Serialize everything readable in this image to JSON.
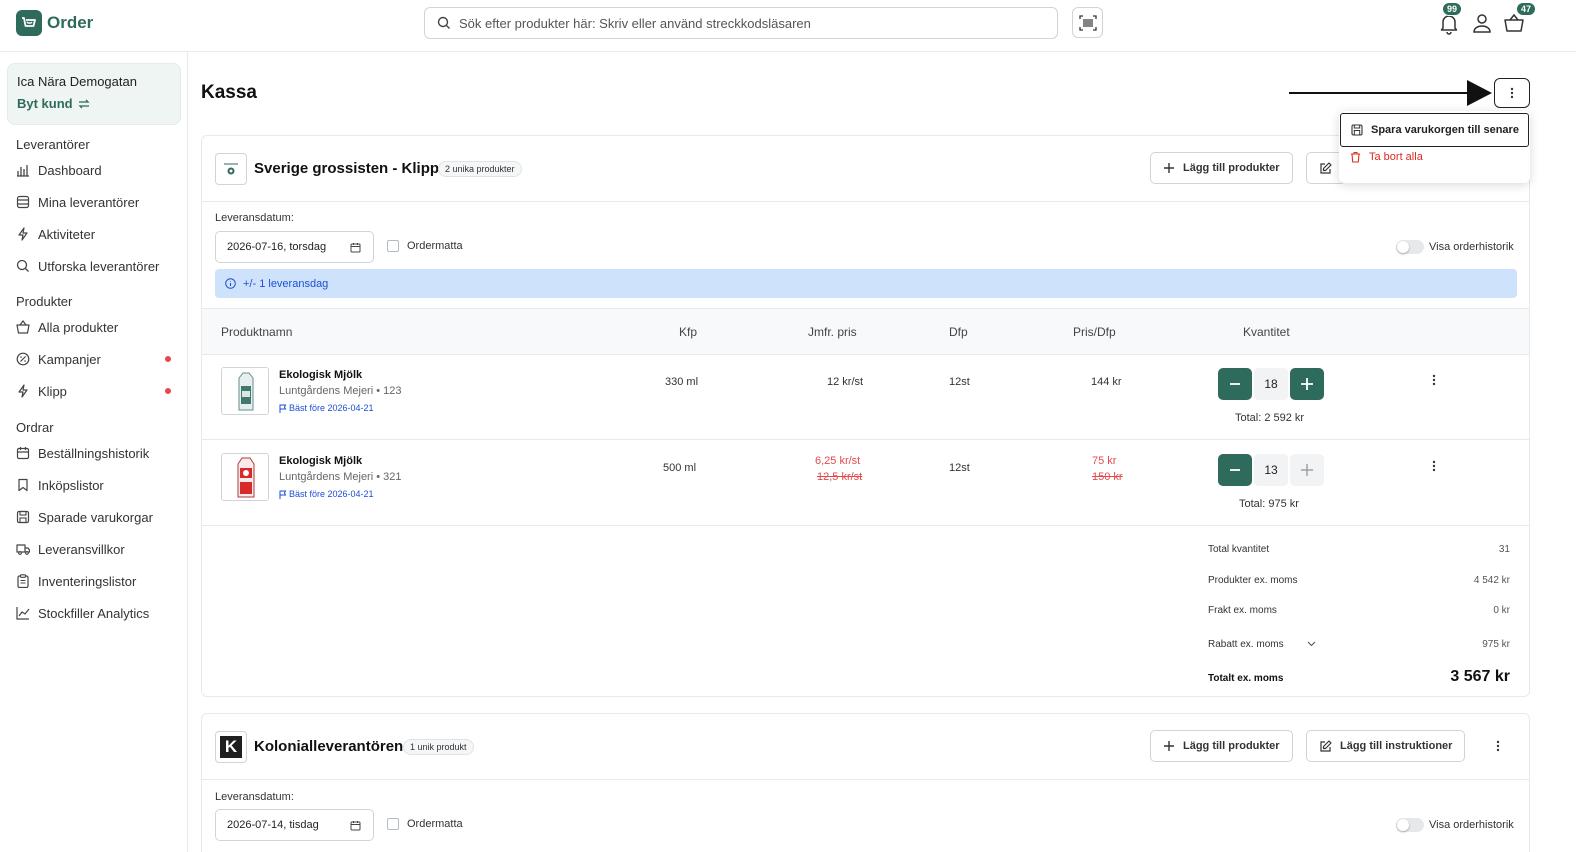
{
  "header": {
    "app_name": "Order",
    "search_placeholder": "Sök efter produkter här: Skriv eller använd streckkodsläsaren",
    "notifications_count": "99",
    "cart_count": "47"
  },
  "sidebar": {
    "customer_name": "Ica Nära Demogatan",
    "switch_customer": "Byt kund",
    "sections": [
      {
        "title": "Leverantörer",
        "items": [
          {
            "label": "Dashboard",
            "icon": "chart-icon"
          },
          {
            "label": "Mina leverantörer",
            "icon": "database-icon"
          },
          {
            "label": "Aktiviteter",
            "icon": "bolt-icon"
          },
          {
            "label": "Utforska leverantörer",
            "icon": "search-icon"
          }
        ]
      },
      {
        "title": "Produkter",
        "items": [
          {
            "label": "Alla produkter",
            "icon": "basket-icon"
          },
          {
            "label": "Kampanjer",
            "icon": "tag-icon",
            "dot": true
          },
          {
            "label": "Klipp",
            "icon": "bolt-icon",
            "dot": true
          }
        ]
      },
      {
        "title": "Ordrar",
        "items": [
          {
            "label": "Beställningshistorik",
            "icon": "calendar-icon"
          },
          {
            "label": "Inköpslistor",
            "icon": "bookmark-icon"
          },
          {
            "label": "Sparade varukorgar",
            "icon": "save-icon"
          },
          {
            "label": "Leveransvillkor",
            "icon": "truck-icon"
          },
          {
            "label": "Inventeringslistor",
            "icon": "clipboard-icon"
          },
          {
            "label": "Stockfiller Analytics",
            "icon": "line-chart-icon"
          }
        ]
      }
    ]
  },
  "page": {
    "title": "Kassa",
    "menu": {
      "save_cart": "Spara varukorgen till senare",
      "delete_all": "Ta bort alla"
    }
  },
  "supplier1": {
    "name": "Sverige grossisten - Klipp",
    "tag": "2 unika produkter",
    "add_products": "Lägg till produkter",
    "delivery_label": "Leveransdatum:",
    "delivery_date": "2026-07-16, torsdag",
    "ordermatta": "Ordermatta",
    "order_history": "Visa orderhistorik",
    "info": "+/- 1 leveransdag",
    "columns": {
      "name": "Produktnamn",
      "kfp": "Kfp",
      "jmfr": "Jmfr. pris",
      "dfp": "Dfp",
      "pris": "Pris/Dfp",
      "qty": "Kvantitet"
    },
    "products": [
      {
        "name": "Ekologisk Mjölk",
        "supplier": "Luntgårdens Mejeri • 123",
        "best_before": "Bäst före 2026-04-21",
        "kfp": "330 ml",
        "jmfr": "12 kr/st",
        "dfp": "12st",
        "price": "144 kr",
        "qty": "18",
        "total": "Total: 2 592 kr"
      },
      {
        "name": "Ekologisk Mjölk",
        "supplier": "Luntgårdens Mejeri • 321",
        "best_before": "Bäst före 2026-04-21",
        "kfp": "500 ml",
        "jmfr": "6,25 kr/st",
        "jmfr_old": "12,5 kr/st",
        "dfp": "12st",
        "price": "75 kr",
        "price_old": "150 kr",
        "qty": "13",
        "total": "Total: 975 kr"
      }
    ],
    "summary": {
      "total_qty_label": "Total kvantitet",
      "total_qty": "31",
      "products_label": "Produkter ex. moms",
      "products": "4 542 kr",
      "freight_label": "Frakt ex. moms",
      "freight": "0 kr",
      "discount_label": "Rabatt ex. moms",
      "discount": "975 kr",
      "total_label": "Totalt ex. moms",
      "total": "3 567 kr"
    }
  },
  "supplier2": {
    "name": "Kolonialleverantören",
    "tag": "1 unik produkt",
    "logo_letter": "K",
    "add_products": "Lägg till produkter",
    "add_instructions": "Lägg till instruktioner",
    "delivery_label": "Leveransdatum:",
    "delivery_date": "2026-07-14, tisdag",
    "ordermatta": "Ordermatta",
    "order_history": "Visa orderhistorik"
  },
  "colors": {
    "brand": "#2f6b5c",
    "danger": "#e5484d",
    "info_bg": "#cfe2fb"
  }
}
